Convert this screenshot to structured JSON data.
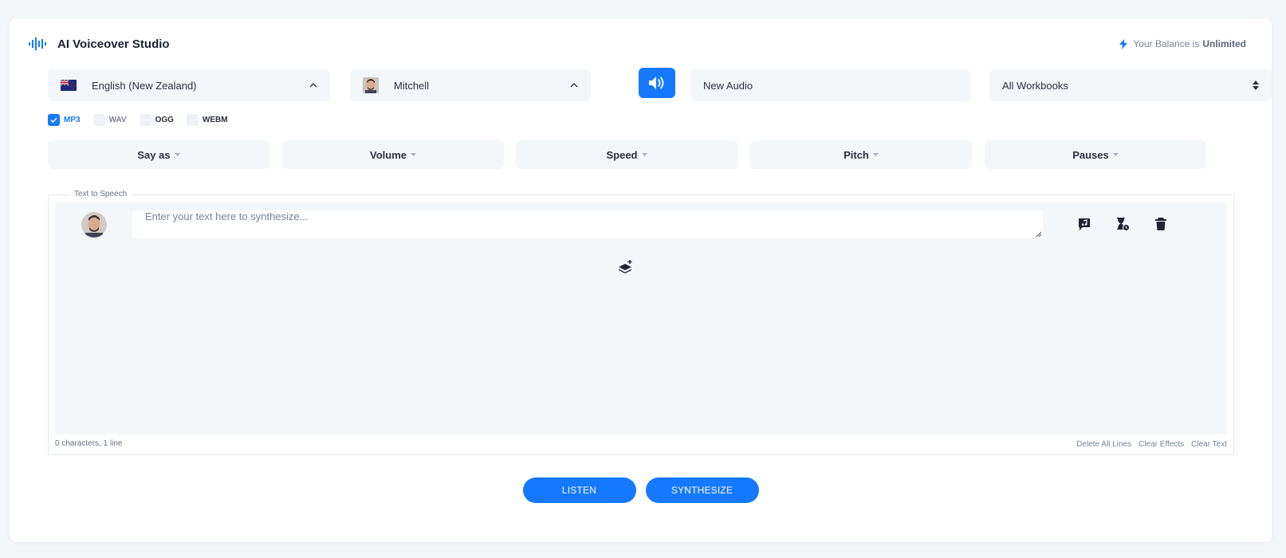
{
  "app": {
    "title": "AI Voiceover Studio",
    "logo_icon": "audio-wave-icon"
  },
  "balance": {
    "prefix": "Your Balance is",
    "value": "Unlimited",
    "icon": "lightning-icon"
  },
  "language": {
    "selected": "English (New Zealand)",
    "flag": "new-zealand-flag"
  },
  "voice": {
    "selected": "Mitchell"
  },
  "audio_name": {
    "value": "New Audio"
  },
  "workbook": {
    "selected": "All Workbooks"
  },
  "formats": [
    {
      "label": "MP3",
      "checked": true
    },
    {
      "label": "WAV",
      "checked": false
    },
    {
      "label": "OGG",
      "checked": false
    },
    {
      "label": "WEBM",
      "checked": false
    }
  ],
  "effects": [
    "Say as",
    "Volume",
    "Speed",
    "Pitch",
    "Pauses"
  ],
  "tts": {
    "legend": "Text to Speech",
    "placeholder": "Enter your text here to synthesize...",
    "stats": "0 characters, 1 line",
    "footer_links": [
      "Delete All Lines",
      "Clear Effects",
      "Clear Text"
    ]
  },
  "actions": {
    "listen": "LISTEN",
    "synthesize": "SYNTHESIZE"
  },
  "colors": {
    "accent": "#1479ff",
    "background": "#f4f7fa"
  }
}
